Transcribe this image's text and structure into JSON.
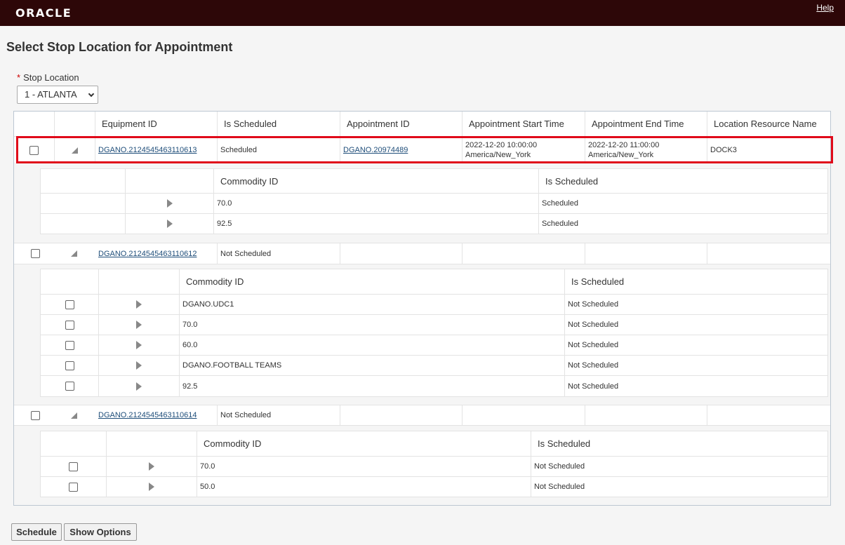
{
  "header": {
    "logo_text": "ORACLE",
    "help_label": "Help"
  },
  "page": {
    "title": "Select Stop Location for Appointment"
  },
  "stop_location": {
    "label": "Stop Location",
    "required_marker": "*",
    "value": "1 - ATLANTA"
  },
  "table": {
    "headers": [
      "Equipment ID",
      "Is Scheduled",
      "Appointment ID",
      "Appointment Start Time",
      "Appointment End Time",
      "Location Resource Name"
    ],
    "rows": [
      {
        "equipment_id": "DGANO.2124545463110613",
        "is_scheduled": "Scheduled",
        "appointment_id": "DGANO.20974489",
        "start_date": "2022-12-20 10:00:00",
        "start_tz": "America/New_York",
        "end_date": "2022-12-20 11:00:00",
        "end_tz": "America/New_York",
        "resource": "DOCK3",
        "detail_headers": [
          "Commodity ID",
          "Is Scheduled"
        ],
        "details": [
          {
            "commodity": "70.0",
            "scheduled": "Scheduled"
          },
          {
            "commodity": "92.5",
            "scheduled": "Scheduled"
          }
        ]
      },
      {
        "equipment_id": "DGANO.2124545463110612",
        "is_scheduled": "Not Scheduled",
        "detail_headers": [
          "Commodity ID",
          "Is Scheduled"
        ],
        "details": [
          {
            "commodity": "DGANO.UDC1",
            "scheduled": "Not Scheduled"
          },
          {
            "commodity": "70.0",
            "scheduled": "Not Scheduled"
          },
          {
            "commodity": "60.0",
            "scheduled": "Not Scheduled"
          },
          {
            "commodity": "DGANO.FOOTBALL TEAMS",
            "scheduled": "Not Scheduled"
          },
          {
            "commodity": "92.5",
            "scheduled": "Not Scheduled"
          }
        ]
      },
      {
        "equipment_id": "DGANO.2124545463110614",
        "is_scheduled": "Not Scheduled",
        "detail_headers": [
          "Commodity ID",
          "Is Scheduled"
        ],
        "details": [
          {
            "commodity": "70.0",
            "scheduled": "Not Scheduled"
          },
          {
            "commodity": "50.0",
            "scheduled": "Not Scheduled"
          }
        ]
      }
    ]
  },
  "buttons": {
    "schedule": "Schedule",
    "show_options": "Show Options"
  },
  "colors": {
    "topbar": "#2d0708",
    "highlight": "#e00a1a",
    "link": "#1f4e7a"
  }
}
